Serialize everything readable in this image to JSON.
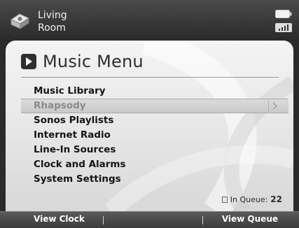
{
  "header": {
    "room_line1": "Living",
    "room_line2": "Room",
    "room_icon": "zone-player-icon",
    "battery_icon": "battery-icon",
    "signal_icon": "signal-icon"
  },
  "menu": {
    "title": "Music Menu",
    "title_icon": "play-icon",
    "items": [
      {
        "label": "Music Library"
      },
      {
        "label": "Rhapsody",
        "selected": true
      },
      {
        "label": "Sonos Playlists"
      },
      {
        "label": "Internet Radio"
      },
      {
        "label": "Line-In Sources"
      },
      {
        "label": "Clock and Alarms"
      },
      {
        "label": "System Settings"
      }
    ]
  },
  "queue": {
    "label": "In Queue:",
    "count": "22"
  },
  "footer": {
    "left_softkey": "View Clock",
    "right_softkey": "View Queue"
  },
  "colors": {
    "panel_top": "#f4f4f4",
    "panel_bottom": "#d8d8d8",
    "chrome": "#2b2b2b",
    "selected_text": "#8a8a8a"
  }
}
